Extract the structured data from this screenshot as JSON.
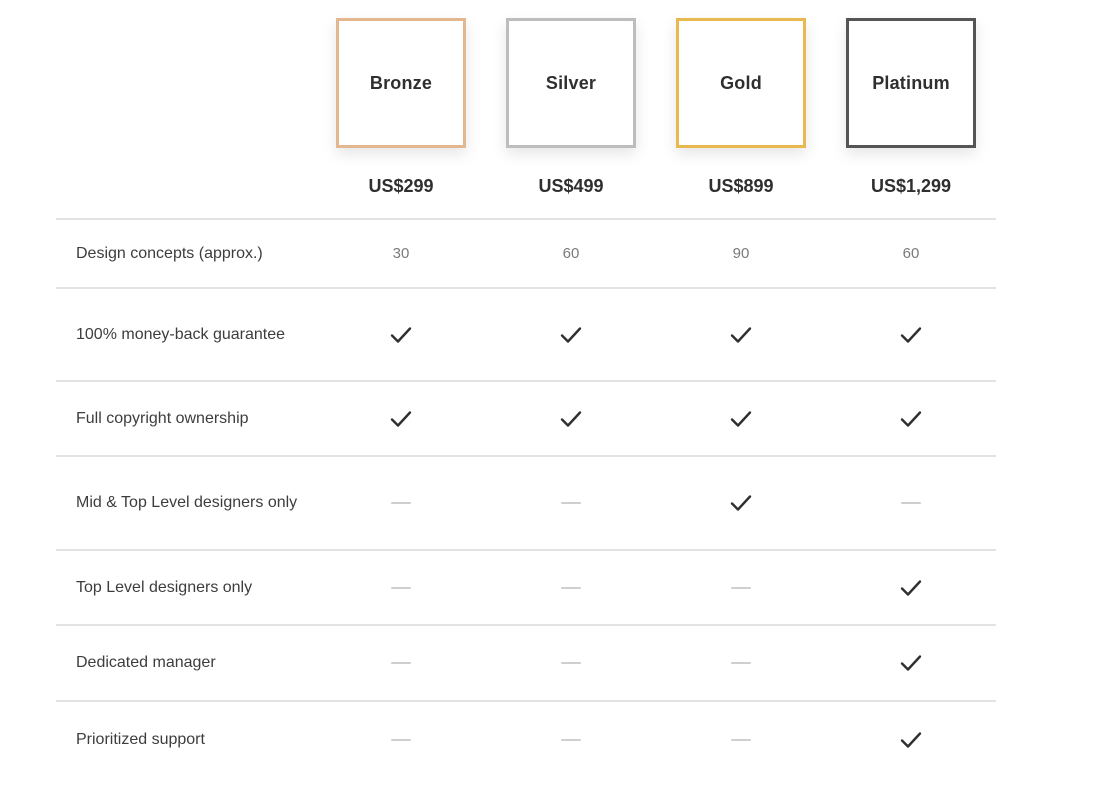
{
  "plans": [
    {
      "name": "Bronze",
      "price": "US$299",
      "color": "#e3b891"
    },
    {
      "name": "Silver",
      "price": "US$499",
      "color": "#bdbdbd"
    },
    {
      "name": "Gold",
      "price": "US$899",
      "color": "#e8b94f"
    },
    {
      "name": "Platinum",
      "price": "US$1,299",
      "color": "#555555"
    }
  ],
  "features": [
    {
      "label": "Design concepts (approx.)",
      "values": [
        "30",
        "60",
        "90",
        "60"
      ]
    },
    {
      "label": "100% money-back guarantee",
      "values": [
        "check-icon",
        "check-icon",
        "check-icon",
        "check-icon"
      ]
    },
    {
      "label": "Full copyright ownership",
      "values": [
        "check-icon",
        "check-icon",
        "check-icon",
        "check-icon"
      ]
    },
    {
      "label": "Mid & Top Level designers only",
      "values": [
        "dash-icon",
        "dash-icon",
        "check-icon",
        "dash-icon"
      ]
    },
    {
      "label": "Top Level designers only",
      "values": [
        "dash-icon",
        "dash-icon",
        "dash-icon",
        "check-icon"
      ]
    },
    {
      "label": "Dedicated manager",
      "values": [
        "dash-icon",
        "dash-icon",
        "dash-icon",
        "check-icon"
      ]
    },
    {
      "label": "Prioritized support",
      "values": [
        "dash-icon",
        "dash-icon",
        "dash-icon",
        "check-icon"
      ]
    }
  ]
}
